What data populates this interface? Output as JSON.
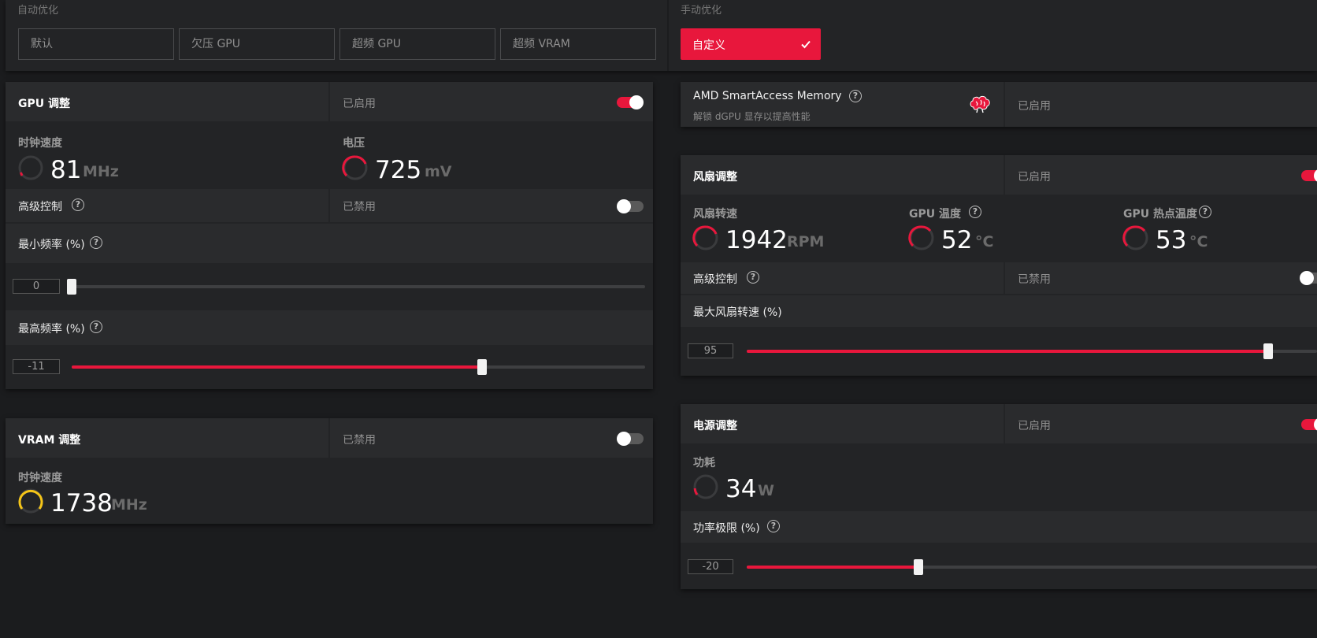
{
  "presets": {
    "auto_label": "自动优化",
    "manual_label": "手动优化",
    "items": [
      "默认",
      "欠压 GPU",
      "超频 GPU",
      "超频 VRAM"
    ],
    "custom": "自定义"
  },
  "gpu_tuning": {
    "title": "GPU 调整",
    "status": "已启用",
    "clock": {
      "label": "时钟速度",
      "value": "81",
      "unit": "MHz"
    },
    "voltage": {
      "label": "电压",
      "value": "725",
      "unit": "mV"
    },
    "advanced": {
      "label": "高级控制",
      "status": "已禁用"
    },
    "min_freq": {
      "label": "最小频率 (%)",
      "value": "0"
    },
    "max_freq": {
      "label": "最高频率 (%)",
      "value": "-11"
    }
  },
  "vram_tuning": {
    "title": "VRAM 调整",
    "status": "已禁用",
    "clock": {
      "label": "时钟速度",
      "value": "1738",
      "unit": "MHz"
    }
  },
  "sam": {
    "title": "AMD SmartAccess Memory",
    "subtitle": "解锁 dGPU 显存以提高性能",
    "status": "已启用"
  },
  "fan_tuning": {
    "title": "风扇调整",
    "status": "已启用",
    "fan_speed": {
      "label": "风扇转速",
      "value": "1942",
      "unit": "RPM"
    },
    "gpu_temp": {
      "label": "GPU 温度",
      "value": "52",
      "unit": "°C"
    },
    "hotspot_temp": {
      "label": "GPU 热点温度",
      "value": "53",
      "unit": "°C"
    },
    "advanced": {
      "label": "高级控制",
      "status": "已禁用"
    },
    "max_fan": {
      "label": "最大风扇转速 (%)",
      "value": "95"
    }
  },
  "power_tuning": {
    "title": "电源调整",
    "status": "已启用",
    "power": {
      "label": "功耗",
      "value": "34",
      "unit": "W"
    },
    "limit": {
      "label": "功率极限 (%)",
      "value": "-20"
    }
  },
  "colors": {
    "accent": "#e8173c",
    "vram_gauge": "#f5c518",
    "panel": "#232426",
    "background": "#1b1c1e"
  },
  "icons": {
    "help": "question-circle-icon",
    "brain": "brain-icon",
    "check": "check-icon",
    "gauge": "gauge-ring-icon"
  }
}
